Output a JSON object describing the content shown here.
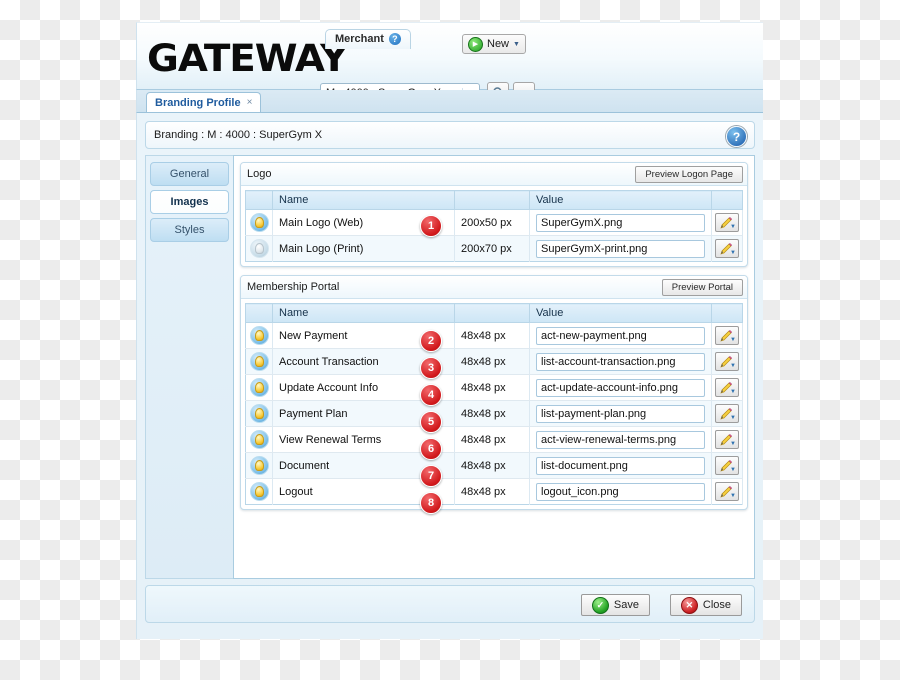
{
  "header": {
    "logo_text": "GATEWAY",
    "merchant_pill_label": "Merchant",
    "merchant_help_icon": "question-mark-icon",
    "merchant_select_value": "M : 4000 : SuperGym X",
    "find_button_icon": "magnifier-icon",
    "more_button_label": "...",
    "new_button_label": "New"
  },
  "tabs": [
    {
      "label": "Branding Profile",
      "close": "×"
    }
  ],
  "breadcrumb": {
    "text": "Branding : M : 4000 : SuperGym X",
    "help_icon": "question-mark-icon",
    "help_label": "?"
  },
  "sidebar": {
    "items": [
      {
        "label": "General",
        "active": false
      },
      {
        "label": "Images",
        "active": true
      },
      {
        "label": "Styles",
        "active": false
      }
    ]
  },
  "sections": [
    {
      "title": "Logo",
      "preview_button": "Preview Logon Page",
      "columns": [
        "",
        "Name",
        "",
        "Value",
        ""
      ],
      "rows": [
        {
          "bulb": "on",
          "name": "Main Logo (Web)",
          "badge": "1",
          "size": "200x50 px",
          "value": "SuperGymX.png"
        },
        {
          "bulb": "off",
          "name": "Main Logo (Print)",
          "badge": "",
          "size": "200x70 px",
          "value": "SuperGymX-print.png"
        }
      ]
    },
    {
      "title": "Membership Portal",
      "preview_button": "Preview Portal",
      "columns": [
        "",
        "Name",
        "",
        "Value",
        ""
      ],
      "rows": [
        {
          "bulb": "on",
          "name": "New Payment",
          "badge": "2",
          "size": "48x48 px",
          "value": "act-new-payment.png"
        },
        {
          "bulb": "on",
          "name": "Account Transaction",
          "badge": "3",
          "size": "48x48 px",
          "value": "list-account-transaction.png"
        },
        {
          "bulb": "on",
          "name": "Update Account Info",
          "badge": "4",
          "size": "48x48 px",
          "value": "act-update-account-info.png"
        },
        {
          "bulb": "on",
          "name": "Payment Plan",
          "badge": "5",
          "size": "48x48 px",
          "value": "list-payment-plan.png"
        },
        {
          "bulb": "on",
          "name": "View Renewal Terms",
          "badge": "6",
          "size": "48x48 px",
          "value": "act-view-renewal-terms.png"
        },
        {
          "bulb": "on",
          "name": "Document",
          "badge": "7",
          "size": "48x48 px",
          "value": "list-document.png"
        },
        {
          "bulb": "on",
          "name": "Logout",
          "badge": "8",
          "size": "48x48 px",
          "value": "logout_icon.png"
        }
      ]
    }
  ],
  "footer": {
    "save_label": "Save",
    "close_label": "Close"
  },
  "colors": {
    "accent_blue": "#1f5b9e",
    "badge_red": "#d1181b",
    "ok_green": "#23a324",
    "panel_bg": "#e6f1f8"
  }
}
